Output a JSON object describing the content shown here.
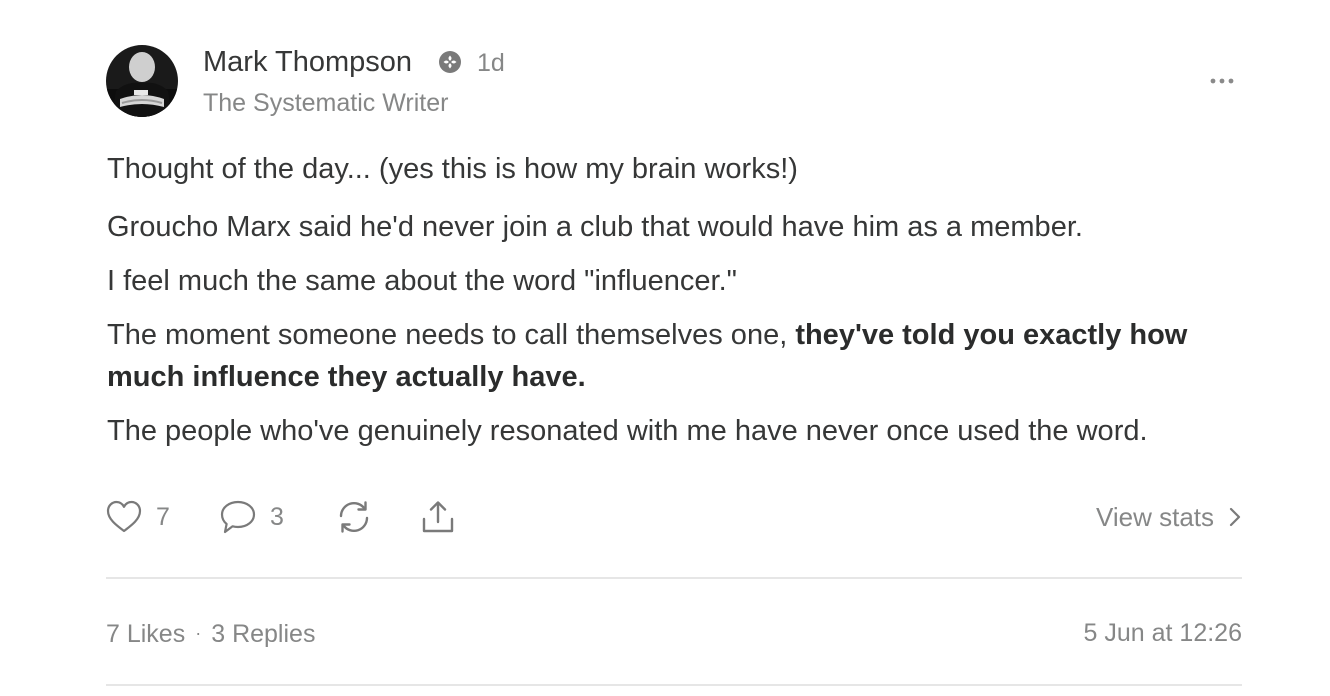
{
  "author": {
    "name": "Mark Thompson",
    "subtitle": "The Systematic Writer",
    "time": "1d"
  },
  "post": {
    "paragraphs": [
      "Thought of the day... (yes this is how my brain works!)",
      "Groucho Marx said he'd never join a club that would have him as a member.",
      "I feel much the same about the word \"influencer.\""
    ],
    "p4_regular": "The moment someone needs to call themselves one, ",
    "p4_bold": "they've told you exactly how much influence they actually have.",
    "last": "The people who've genuinely resonated with me have never once used the word."
  },
  "actions": {
    "likes": "7",
    "replies": "3",
    "view_stats": "View stats"
  },
  "footer": {
    "likes_text": "7 Likes",
    "separator": "·",
    "replies_text": "3 Replies",
    "timestamp": "5 Jun at 12:26"
  },
  "icons": {
    "badge": "badge-icon",
    "more": "more-icon",
    "like": "heart-icon",
    "comment": "comment-icon",
    "restack": "restack-icon",
    "share": "share-icon",
    "chevron": "chevron-right-icon"
  },
  "colors": {
    "text": "#363737",
    "muted": "#868787",
    "divider": "#e6e6e6"
  }
}
